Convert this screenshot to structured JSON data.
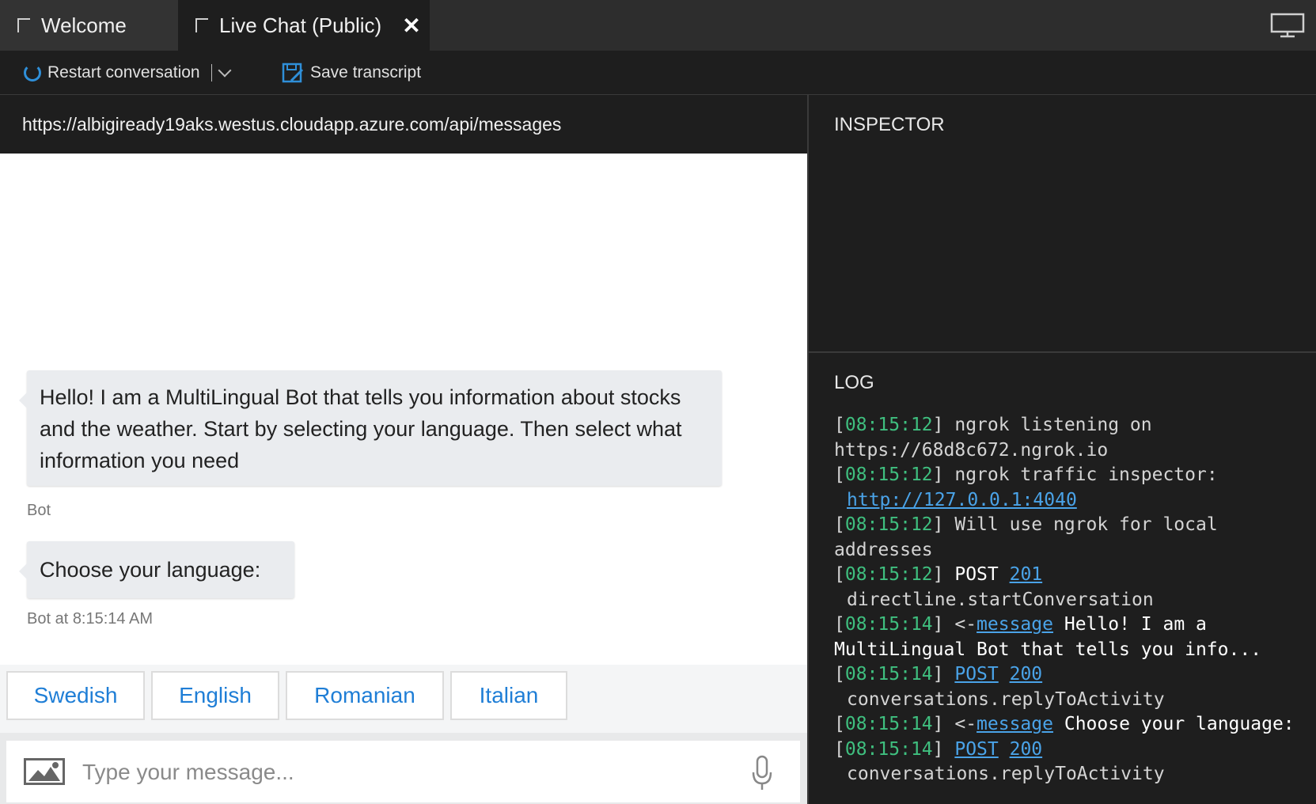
{
  "tabs": [
    {
      "label": "Welcome"
    },
    {
      "label": "Live Chat (Public)"
    }
  ],
  "toolbar": {
    "restart_label": "Restart conversation",
    "save_label": "Save transcript"
  },
  "endpoint_url": "https://albigiready19aks.westus.cloudapp.azure.com/api/messages",
  "chat": {
    "messages": [
      {
        "text": "Hello! I am a MultiLingual Bot that tells you information about stocks and the weather. Start by selecting your language. Then select what information you need",
        "meta": "Bot"
      },
      {
        "text": "Choose your language:",
        "meta": "Bot at 8:15:14 AM"
      }
    ],
    "suggested_actions": [
      "Swedish",
      "English",
      "Romanian",
      "Italian"
    ],
    "input_placeholder": "Type your message..."
  },
  "inspector": {
    "title": "INSPECTOR"
  },
  "log": {
    "title": "LOG",
    "entries": [
      {
        "time": "08:15:12",
        "text": "ngrok listening on",
        "cont": "https://68d8c672.ngrok.io"
      },
      {
        "time": "08:15:12",
        "text": "ngrok traffic inspector:",
        "link": "http://127.0.0.1:4040"
      },
      {
        "time": "08:15:12",
        "text": "Will use ngrok for local",
        "cont": "addresses"
      },
      {
        "time": "08:15:12",
        "method": "POST",
        "status": "201",
        "cont": "directline.startConversation"
      },
      {
        "time": "08:15:14",
        "arrow": "<-",
        "kind": "message",
        "text": "Hello! I am a",
        "cont": "MultiLingual Bot that tells you info..."
      },
      {
        "time": "08:15:14",
        "method": "POST",
        "status": "200",
        "cont": "conversations.replyToActivity"
      },
      {
        "time": "08:15:14",
        "arrow": "<-",
        "kind": "message",
        "text": "Choose your language:"
      },
      {
        "time": "08:15:14",
        "method": "POST",
        "status": "200",
        "cont": "conversations.replyToActivity"
      }
    ]
  },
  "colors": {
    "accent": "#1f7ed6",
    "timestamp": "#3fbf7f",
    "link": "#4aa3e8"
  }
}
